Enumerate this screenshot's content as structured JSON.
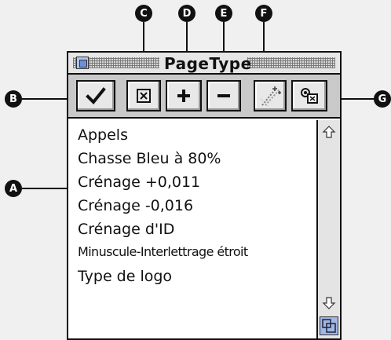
{
  "window": {
    "title": "PageType"
  },
  "toolbar": {
    "buttons": [
      {
        "name": "apply",
        "icon": "checkmark-icon"
      },
      {
        "name": "remove",
        "icon": "boxed-x-icon"
      },
      {
        "name": "new",
        "icon": "plus-icon"
      },
      {
        "name": "delete",
        "icon": "minus-icon"
      },
      {
        "name": "magic-wand",
        "icon": "wand-icon"
      },
      {
        "name": "edit",
        "icon": "options-icon"
      }
    ]
  },
  "list": {
    "items": [
      "Appels",
      "Chasse Bleu à 80%",
      "Crénage +0,011",
      "Crénage -0,016",
      "Crénage d'ID",
      "Minuscule-Interlettrage étroit",
      "Type de logo"
    ]
  },
  "callouts": {
    "a": "A",
    "b": "B",
    "c": "C",
    "d": "D",
    "e": "E",
    "f": "F",
    "g": "G"
  }
}
